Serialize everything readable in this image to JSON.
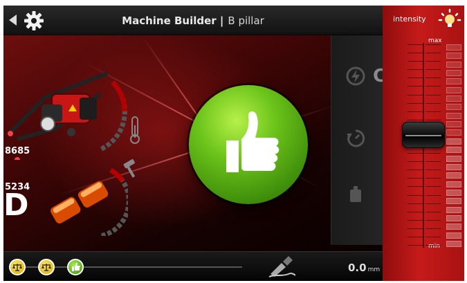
{
  "header": {
    "title": "Machine Builder |",
    "subtitle": "B pillar",
    "back_icon": "back-arrow-icon",
    "settings_icon": "gear-icon"
  },
  "main": {
    "value_top": "8685",
    "value_bottom": "5234",
    "grade_letter": "D",
    "partial_label": "C",
    "status_button_icon": "thumbs-up-icon",
    "status": "ok"
  },
  "bottom": {
    "distance": "0.0",
    "unit": "mm",
    "steps": [
      {
        "icon": "scale-icon",
        "state": "done"
      },
      {
        "icon": "scale-icon",
        "state": "done"
      },
      {
        "icon": "thumbs-up-icon",
        "state": "ok"
      }
    ]
  },
  "intensity": {
    "label": "intensity",
    "max_label": "max",
    "min_label": "min",
    "level_fraction": 0.55
  },
  "colors": {
    "accent_red": "#c61a1a",
    "ok_green": "#6cc41a",
    "warning_yellow": "#d9a800"
  }
}
